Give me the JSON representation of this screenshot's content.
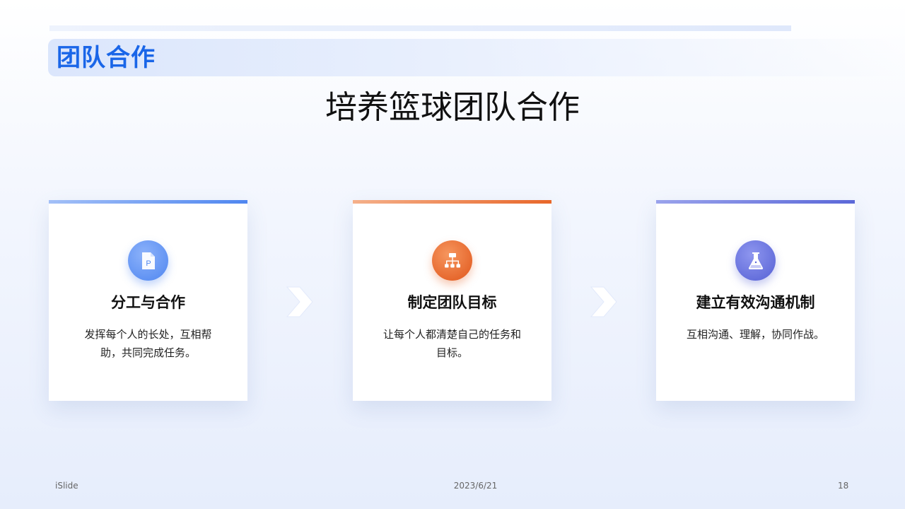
{
  "header": {
    "section_title": "团队合作"
  },
  "main_title": "培养篮球团队合作",
  "cards": [
    {
      "title": "分工与合作",
      "text": "发挥每个人的长处，互相帮助，共同完成任务。",
      "icon": "document-p-icon",
      "color": "#4f86f0"
    },
    {
      "title": "制定团队目标",
      "text": "让每个人都清楚自己的任务和目标。",
      "icon": "org-chart-icon",
      "color": "#e8672a"
    },
    {
      "title": "建立有效沟通机制",
      "text": "互相沟通、理解，协同作战。",
      "icon": "flask-icon",
      "color": "#5b68d8"
    }
  ],
  "footer": {
    "left": "iSlide",
    "date": "2023/6/21",
    "page": "18"
  }
}
